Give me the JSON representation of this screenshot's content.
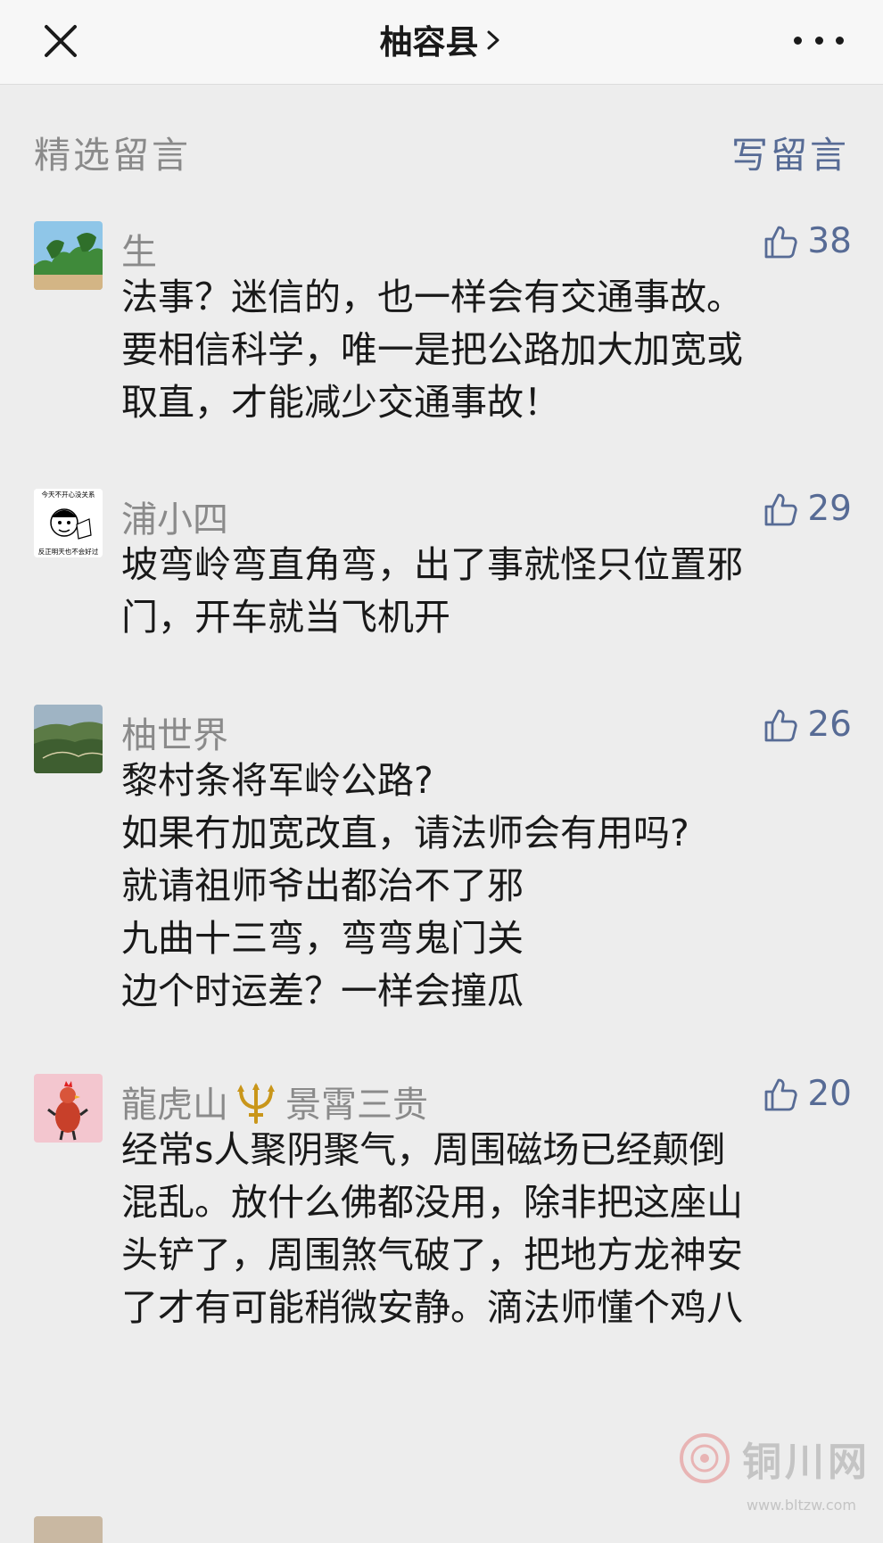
{
  "header": {
    "title": "柚容县",
    "chevron_icon": "chevron-right-icon",
    "close_icon": "close-icon",
    "more_icon": "more-dots-icon"
  },
  "section": {
    "title": "精选留言",
    "write_label": "写留言"
  },
  "colors": {
    "link": "#576b95",
    "muted": "#8a8a8a",
    "background": "#ededed"
  },
  "comments": [
    {
      "name": "生",
      "likes": "38",
      "lines": [
        "法事？迷信的，也一样会有交通事故。",
        "要相信科学，唯一是把公路加大加宽或",
        "取直，才能减少交通事故！"
      ]
    },
    {
      "name": "浦小四",
      "likes": "29",
      "avatar_caption_top": "今天不开心没关系",
      "avatar_caption_bottom": "反正明天也不会好过",
      "lines": [
        "坡弯岭弯直角弯，出了事就怪只位置邪",
        "门，开车就当飞机开"
      ]
    },
    {
      "name": "柚世界",
      "likes": "26",
      "lines": [
        "黎村条将军岭公路?",
        "如果冇加宽改直，请法师会有用吗?",
        "就请祖师爷出都治不了邪",
        "九曲十三弯，弯弯鬼门关",
        "边个时运差？一样会撞瓜"
      ]
    },
    {
      "name_a": "龍虎山",
      "name_b": "景霄三贵",
      "likes": "20",
      "lines": [
        "经常s人聚阴聚气，周围磁场已经颠倒",
        "混乱。放什么佛都没用，除非把这座山",
        "头铲了，周围煞气破了，把地方龙神安",
        "了才有可能稍微安静。滴法师懂个鸡八"
      ]
    }
  ],
  "watermark": {
    "text": "铜川网",
    "url": "www.bltzw.com"
  }
}
